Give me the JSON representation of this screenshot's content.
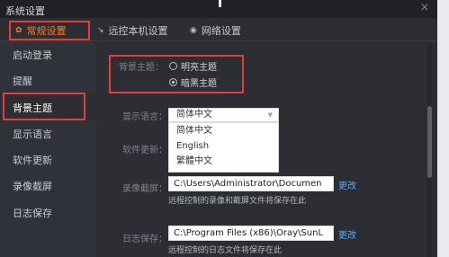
{
  "window": {
    "title": "系统设置",
    "close_glyph": "×"
  },
  "tabs": [
    {
      "label": "常规设置",
      "icon": "gear-icon",
      "active": true
    },
    {
      "label": "远控本机设置",
      "icon": "remote-icon",
      "active": false
    },
    {
      "label": "网络设置",
      "icon": "network-icon",
      "active": false
    }
  ],
  "sidebar": {
    "items": [
      {
        "label": "启动登录"
      },
      {
        "label": "提醒"
      },
      {
        "label": "背景主题",
        "active": true
      },
      {
        "label": "显示语言"
      },
      {
        "label": "软件更新"
      },
      {
        "label": "录像截屏"
      },
      {
        "label": "日志保存"
      }
    ]
  },
  "background_theme": {
    "label": "背景主题：",
    "options": [
      {
        "label": "明亮主题",
        "selected": false
      },
      {
        "label": "暗黑主题",
        "selected": true
      }
    ]
  },
  "display_language": {
    "label": "显示语言：",
    "selected": "简体中文",
    "options": [
      "简体中文",
      "English",
      "繁體中文"
    ]
  },
  "software_update": {
    "label": "软件更新："
  },
  "recording": {
    "label": "录像截屏：",
    "path": "C:\\Users\\Administrator\\Documen",
    "change": "更改",
    "hint": "远程控制的录像和截屏文件将保存在此"
  },
  "log_save": {
    "label": "日志保存：",
    "path": "C:\\Program Files (x86)\\Oray\\SunL",
    "change": "更改",
    "hint": "远程控制的日志文件将保存在此"
  },
  "colors": {
    "accent": "#ff7a29",
    "highlight_border": "#e53c3c",
    "link": "#5aa8ff",
    "background": "#2c2e34"
  }
}
